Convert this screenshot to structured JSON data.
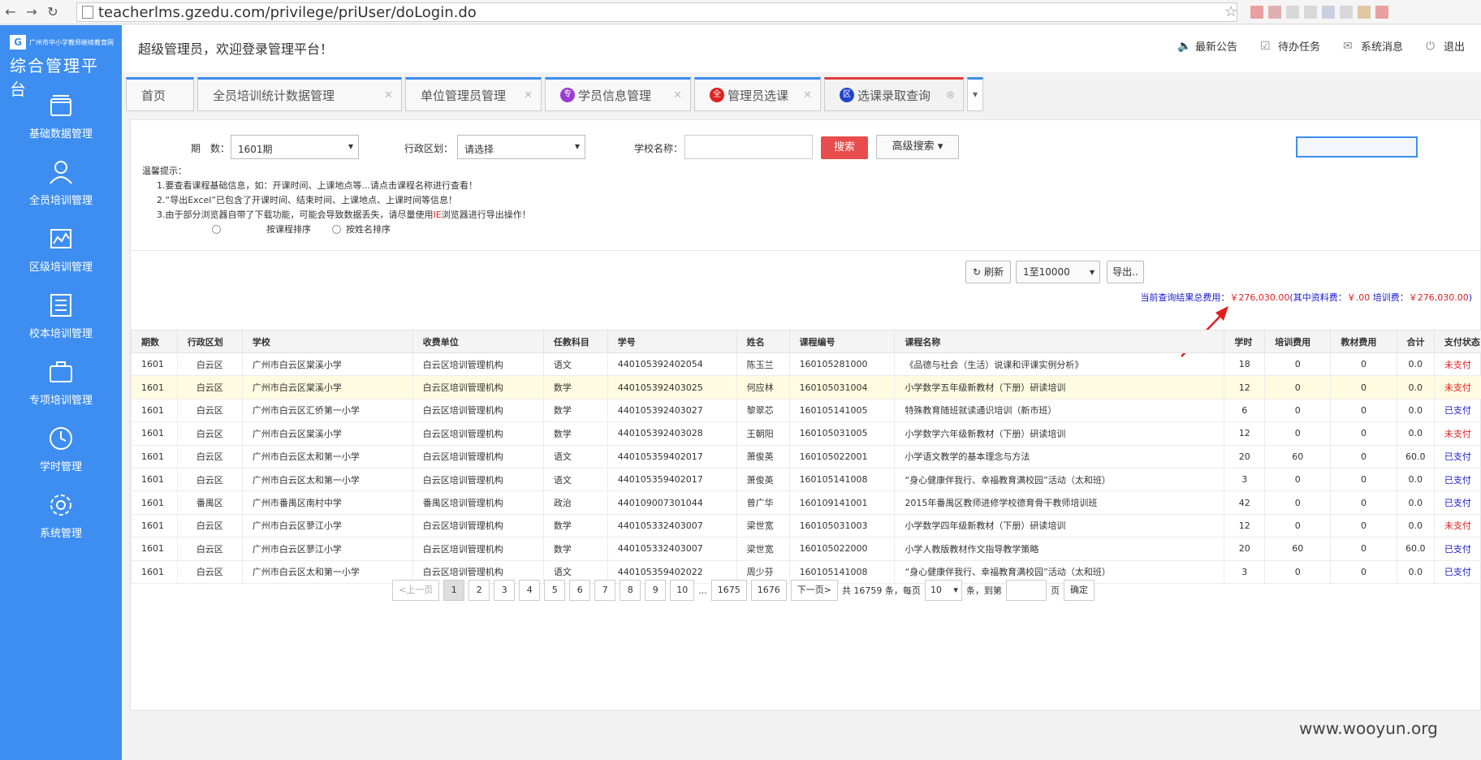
{
  "browser": {
    "url": "teacherlms.gzedu.com/privilege/priUser/doLogin.do"
  },
  "sidebar": {
    "logo_small": "广州市中小学教师继续教育网",
    "logo_title": "综合管理平台",
    "items": [
      {
        "label": "基础数据管理",
        "icon": "folder-icon"
      },
      {
        "label": "全员培训管理",
        "icon": "user-icon"
      },
      {
        "label": "区级培训管理",
        "icon": "chart-icon"
      },
      {
        "label": "校本培训管理",
        "icon": "list-icon"
      },
      {
        "label": "专项培训管理",
        "icon": "briefcase-icon"
      },
      {
        "label": "学时管理",
        "icon": "clock-icon"
      },
      {
        "label": "系统管理",
        "icon": "gear-icon"
      }
    ]
  },
  "header": {
    "welcome": "超级管理员，欢迎登录管理平台！",
    "links": [
      {
        "label": "最新公告",
        "icon": "speaker-icon"
      },
      {
        "label": "待办任务",
        "icon": "task-icon"
      },
      {
        "label": "系统消息",
        "icon": "mail-icon"
      },
      {
        "label": "退出",
        "icon": "power-icon"
      }
    ]
  },
  "tabs": [
    {
      "label": "首页"
    },
    {
      "label": "全员培训统计数据管理"
    },
    {
      "label": "单位管理员管理"
    },
    {
      "label": "学员信息管理",
      "badge": "专",
      "badge_color": "#9b3bd1"
    },
    {
      "label": "管理员选课",
      "badge": "全",
      "badge_color": "#e02020"
    },
    {
      "label": "选课录取查询",
      "badge": "区",
      "badge_color": "#2244cc"
    }
  ],
  "filters": {
    "period_label": "期　数：",
    "period_value": "1601期",
    "district_label": "行政区划：",
    "district_value": "请选择",
    "school_label": "学校名称：",
    "search_label": "搜索",
    "advanced_label": "高级搜索"
  },
  "tips": {
    "title": "温馨提示：",
    "line1": "1.要查看课程基础信息，如：开课时间、上课地点等...请点击课程名称进行查看！",
    "line2": "2.“导出Excel”已包含了开课时间、结束时间、上课地点、上课时间等信息！",
    "line3a": "3.由于部分浏览器自带了下载功能，可能会导致数据丢失，请尽量使用",
    "line3ie": "IE",
    "line3b": "浏览器进行导出操作！",
    "sort_course": "按课程排序",
    "sort_name": "按姓名排序"
  },
  "tools": {
    "refresh": "刷新",
    "range": "1至10000",
    "export": "导出.."
  },
  "cost": {
    "prefix": "当前查询结果总费用：",
    "total": "￥276,030.00",
    "mid": "(其中资料费：",
    "material": "￥.00",
    "train_label": " 培训费：",
    "train": "￥276,030.00",
    "suffix": ")"
  },
  "table": {
    "headers": [
      "期数",
      "行政区划",
      "学校",
      "收费单位",
      "任教科目",
      "学号",
      "姓名",
      "课程编号",
      "课程名称",
      "学时",
      "培训费用",
      "教材费用",
      "合计",
      "支付状态"
    ],
    "rows": [
      [
        "1601",
        "白云区",
        "广州市白云区棠溪小学",
        "白云区培训管理机构",
        "语文",
        "440105392402054",
        "陈玉兰",
        "160105281000",
        "《品德与社会（生活）说课和评课实例分析》",
        "18",
        "0",
        "0",
        "0.0",
        "未支付"
      ],
      [
        "1601",
        "白云区",
        "广州市白云区棠溪小学",
        "白云区培训管理机构",
        "数学",
        "440105392403025",
        "何应林",
        "160105031004",
        "小学数学五年级新教材（下册）研读培训",
        "12",
        "0",
        "0",
        "0.0",
        "未支付"
      ],
      [
        "1601",
        "白云区",
        "广州市白云区汇侨第一小学",
        "白云区培训管理机构",
        "数学",
        "440105392403027",
        "黎翠芯",
        "160105141005",
        "特殊教育随班就读通识培训（新市班）",
        "6",
        "0",
        "0",
        "0.0",
        "已支付"
      ],
      [
        "1601",
        "白云区",
        "广州市白云区棠溪小学",
        "白云区培训管理机构",
        "数学",
        "440105392403028",
        "王朝阳",
        "160105031005",
        "小学数学六年级新教材（下册）研读培训",
        "12",
        "0",
        "0",
        "0.0",
        "未支付"
      ],
      [
        "1601",
        "白云区",
        "广州市白云区太和第一小学",
        "白云区培训管理机构",
        "语文",
        "440105359402017",
        "萧俊英",
        "160105022001",
        "小学语文教学的基本理念与方法",
        "20",
        "60",
        "0",
        "60.0",
        "已支付"
      ],
      [
        "1601",
        "白云区",
        "广州市白云区太和第一小学",
        "白云区培训管理机构",
        "语文",
        "440105359402017",
        "萧俊英",
        "160105141008",
        "“身心健康伴我行、幸福教育满校园”活动（太和班）",
        "3",
        "0",
        "0",
        "0.0",
        "已支付"
      ],
      [
        "1601",
        "番禺区",
        "广州市番禺区南村中学",
        "番禺区培训管理机构",
        "政治",
        "440109007301044",
        "曾广华",
        "160109141001",
        "2015年番禺区教师进修学校德育骨干教师培训班",
        "42",
        "0",
        "0",
        "0.0",
        "已支付"
      ],
      [
        "1601",
        "白云区",
        "广州市白云区蓼江小学",
        "白云区培训管理机构",
        "数学",
        "440105332403007",
        "梁世宽",
        "160105031003",
        "小学数学四年级新教材（下册）研读培训",
        "12",
        "0",
        "0",
        "0.0",
        "未支付"
      ],
      [
        "1601",
        "白云区",
        "广州市白云区蓼江小学",
        "白云区培训管理机构",
        "数学",
        "440105332403007",
        "梁世宽",
        "160105022000",
        "小学人教版教材作文指导教学策略",
        "20",
        "60",
        "0",
        "60.0",
        "已支付"
      ],
      [
        "1601",
        "白云区",
        "广州市白云区太和第一小学",
        "白云区培训管理机构",
        "语文",
        "440105359402022",
        "周少芬",
        "160105141008",
        "“身心健康伴我行、幸福教育满校园”活动（太和班）",
        "3",
        "0",
        "0",
        "0.0",
        "已支付"
      ]
    ]
  },
  "pager": {
    "prev": "<上一页",
    "pages": [
      "1",
      "2",
      "3",
      "4",
      "5",
      "6",
      "7",
      "8",
      "9",
      "10"
    ],
    "ellipsis": "...",
    "tail": [
      "1675",
      "1676"
    ],
    "next": "下一页>",
    "total_text": "共 16759 条，每页",
    "per_page": "10",
    "goto_text": "条，到第",
    "page_unit": "页",
    "confirm": "确定"
  },
  "watermark": "www.wooyun.org",
  "colors": {
    "sidebar": "#3d8ef0",
    "search_btn": "#e84c4c",
    "unpaid": "#e02020",
    "paid": "#1a1ad0"
  }
}
